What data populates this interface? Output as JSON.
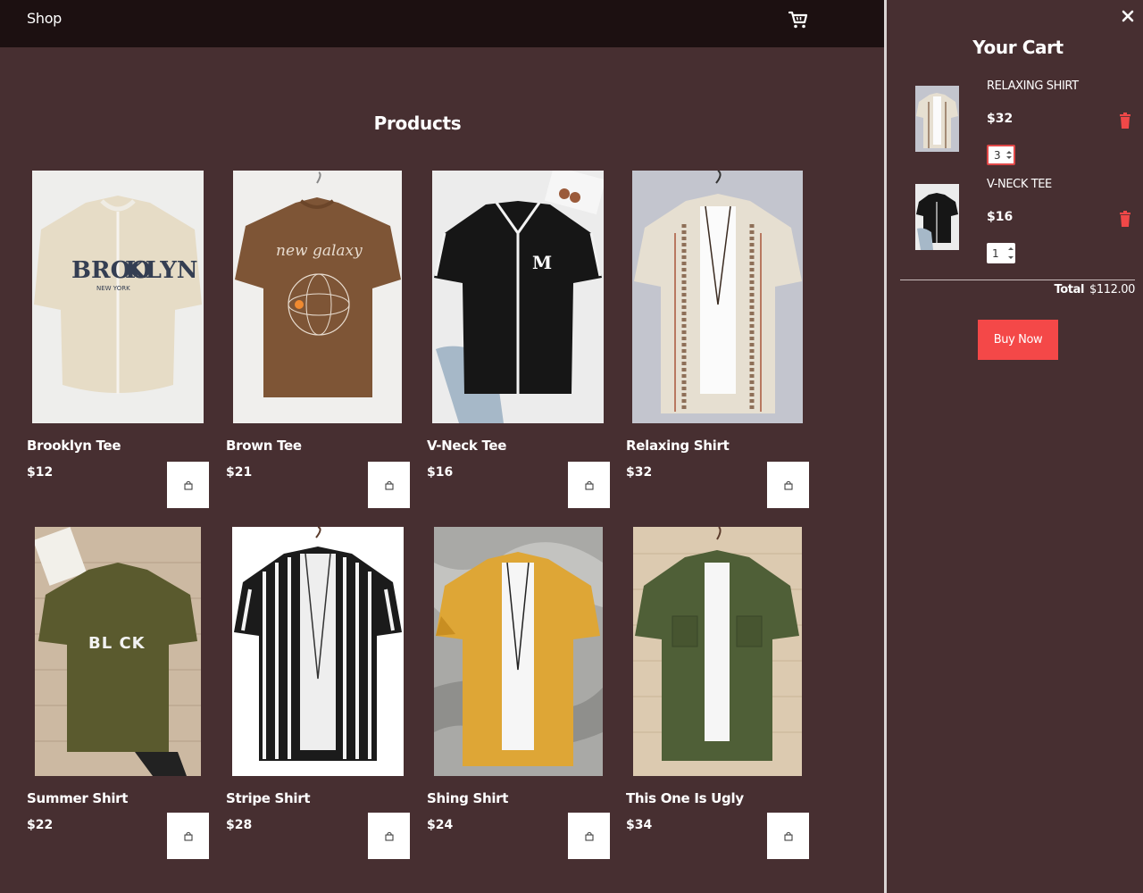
{
  "header": {
    "title": "Shop",
    "cart_icon": "cart-icon"
  },
  "products_heading": "Products",
  "products": [
    {
      "name": "Brooklyn Tee",
      "price": "$12"
    },
    {
      "name": "Brown Tee",
      "price": "$21"
    },
    {
      "name": "V-Neck Tee",
      "price": "$16"
    },
    {
      "name": "Relaxing Shirt",
      "price": "$32"
    },
    {
      "name": "Summer Shirt",
      "price": "$22"
    },
    {
      "name": "Stripe Shirt",
      "price": "$28"
    },
    {
      "name": "Shing Shirt",
      "price": "$24"
    },
    {
      "name": "This One Is Ugly",
      "price": "$34"
    }
  ],
  "product_images": {
    "brooklyn": {
      "print_line1": "BROO",
      "print_line2": "KLYN",
      "print_small": "NEW YORK"
    },
    "brown": {
      "print": "new galaxy"
    },
    "vneck": {
      "print": "M"
    },
    "summer": {
      "print": "BL  CK"
    }
  },
  "cart": {
    "title": "Your Cart",
    "items": [
      {
        "name": "RELAXING SHIRT",
        "price": "$32",
        "qty": "3"
      },
      {
        "name": "V-NECK TEE",
        "price": "$16",
        "qty": "1"
      }
    ],
    "total_label": "Total",
    "total_value": "$112.00",
    "buy_label": "Buy Now"
  },
  "colors": {
    "background": "#472f31",
    "topbar": "#1c1011",
    "accent_red": "#f44848",
    "trash_red": "#f04848"
  }
}
